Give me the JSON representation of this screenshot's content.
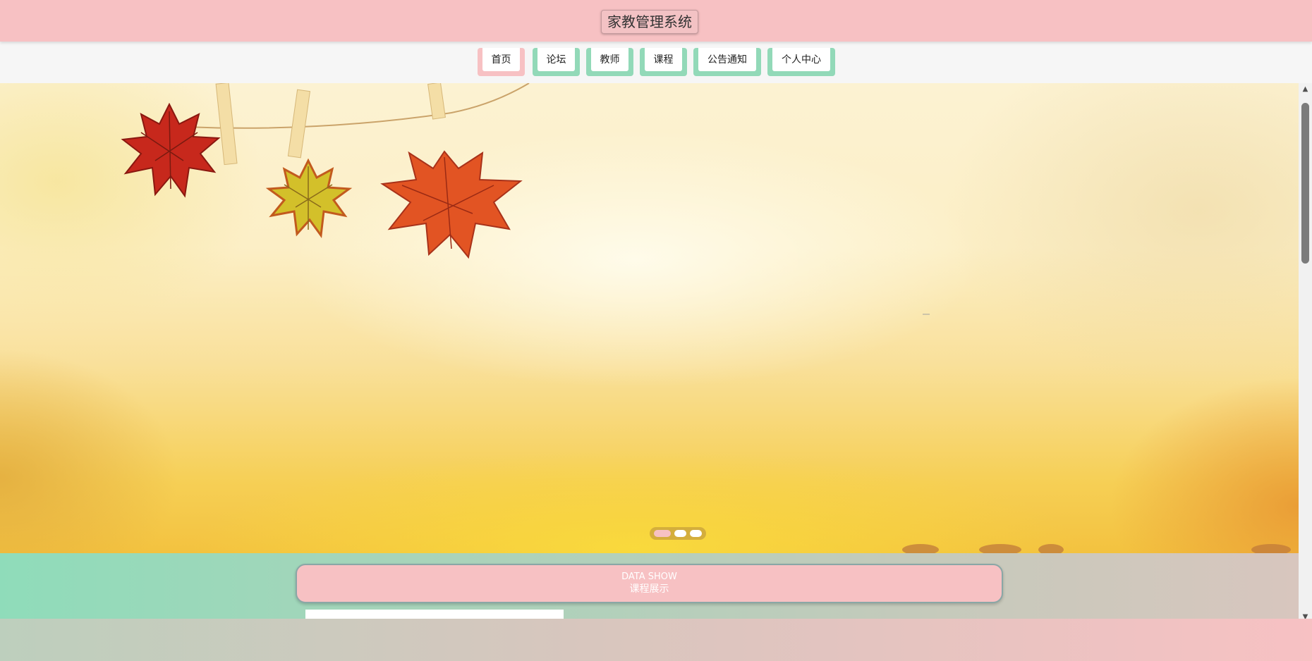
{
  "header": {
    "title": "家教管理系统",
    "bg_color": "#f7c1c3"
  },
  "nav": {
    "items": [
      {
        "label": "首页",
        "active": true
      },
      {
        "label": "论坛",
        "active": false
      },
      {
        "label": "教师",
        "active": false
      },
      {
        "label": "课程",
        "active": false
      },
      {
        "label": "公告通知",
        "active": false
      },
      {
        "label": "个人中心",
        "active": false
      }
    ],
    "active_color": "#f7c1c3",
    "inactive_color": "#92d9b8"
  },
  "carousel": {
    "slide_count": 3,
    "active_index": 0,
    "image_subject": "autumn maple leaves pinned on a clothesline over warm yellow background"
  },
  "section": {
    "title_en": "DATA SHOW",
    "title_cn": "课程展示"
  },
  "scrollbar": {
    "up_icon": "scroll-up-arrow-icon",
    "down_icon": "scroll-down-arrow-icon"
  }
}
